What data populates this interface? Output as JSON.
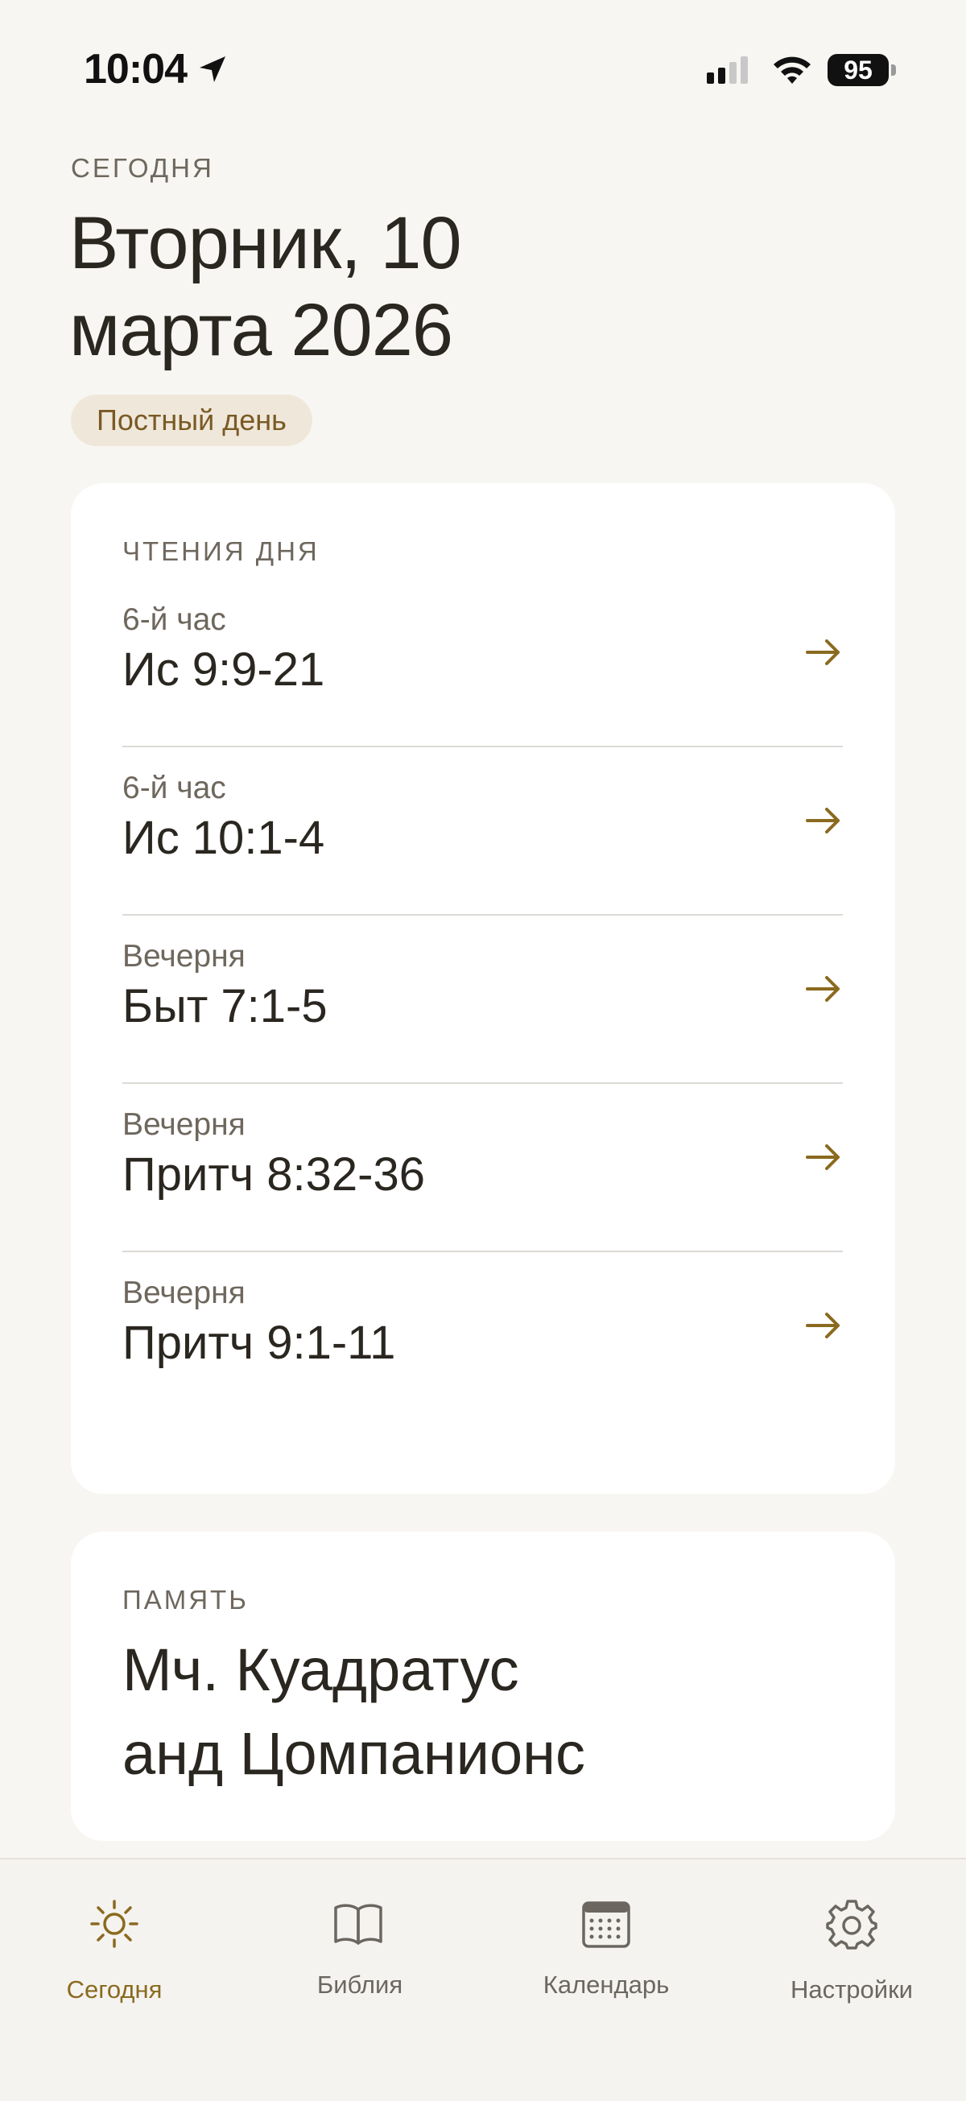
{
  "status_bar": {
    "time": "10:04",
    "battery": "95"
  },
  "header": {
    "eyebrow": "СЕГОДНЯ",
    "title_line1": "Вторник, 10",
    "title_line2": "марта 2026",
    "badge": "Постный день"
  },
  "readings": {
    "heading": "ЧТЕНИЯ ДНЯ",
    "items": [
      {
        "service": "6-й час",
        "ref": "Ис 9:9-21"
      },
      {
        "service": "6-й час",
        "ref": "Ис 10:1-4"
      },
      {
        "service": "Вечерня",
        "ref": "Быт 7:1-5"
      },
      {
        "service": "Вечерня",
        "ref": "Притч 8:32-36"
      },
      {
        "service": "Вечерня",
        "ref": "Притч 9:1-11"
      }
    ]
  },
  "memory": {
    "heading": "ПАМЯТЬ",
    "name_line1": "Мч. Куадратус",
    "name_line2": "анд Цомпанионс"
  },
  "tabs": [
    {
      "label": "Сегодня",
      "icon": "sun-icon",
      "active": true
    },
    {
      "label": "Библия",
      "icon": "book-icon",
      "active": false
    },
    {
      "label": "Календарь",
      "icon": "calendar-icon",
      "active": false
    },
    {
      "label": "Настройки",
      "icon": "gear-icon",
      "active": false
    }
  ],
  "colors": {
    "accent": "#8a6a1f",
    "background": "#f8f6f2",
    "card": "#ffffff",
    "badge": "#efe7da"
  }
}
